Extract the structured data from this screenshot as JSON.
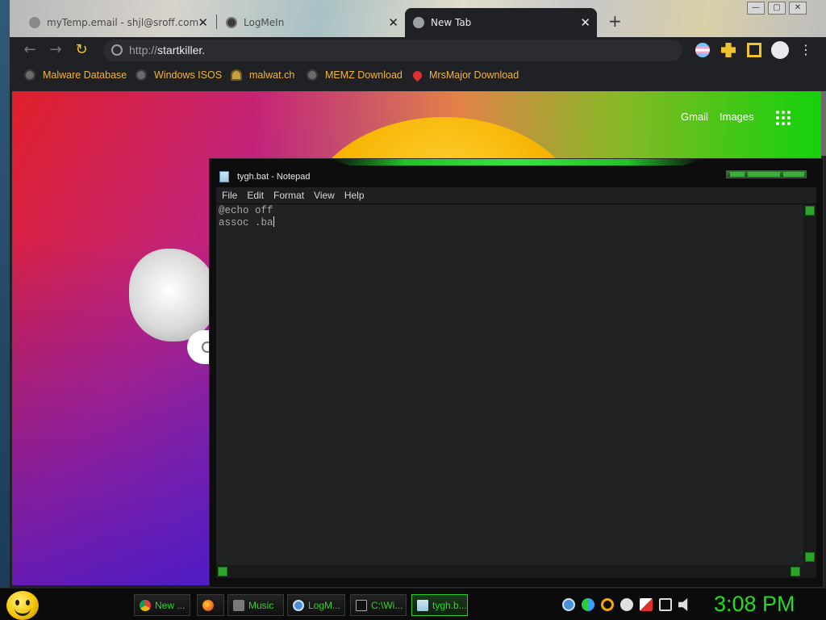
{
  "browser": {
    "tabs": [
      {
        "label": "myTemp.email - shjl@sroff.com",
        "active": false
      },
      {
        "label": "LogMeIn",
        "active": false
      },
      {
        "label": "New Tab",
        "active": true
      }
    ],
    "new_tab_symbol": "+",
    "tab_close_symbol": "✕",
    "window_controls": [
      "—",
      "▢",
      "✕"
    ],
    "nav": {
      "back": "←",
      "forward": "→",
      "reload": "↻"
    },
    "address": {
      "scheme": "http://",
      "host": "startkiller."
    },
    "bookmarks": [
      {
        "label": "Malware Database",
        "icon": "globe-icon"
      },
      {
        "label": "Windows ISOS",
        "icon": "globe-icon"
      },
      {
        "label": "malwat.ch",
        "icon": "person-icon"
      },
      {
        "label": "MEMZ Download",
        "icon": "globe-icon"
      },
      {
        "label": "MrsMajor Download",
        "icon": "heart-icon"
      }
    ],
    "page": {
      "links": [
        "Gmail",
        "Images"
      ]
    }
  },
  "notepad": {
    "title": "tygh.bat - Notepad",
    "menu": [
      "File",
      "Edit",
      "Format",
      "View",
      "Help"
    ],
    "content": "@echo off\nassoc .ba"
  },
  "taskbar": {
    "buttons": [
      {
        "label": "New ...",
        "icon": "chrome-icon",
        "active": false
      },
      {
        "label": "",
        "icon": "firefox-icon",
        "active": false
      },
      {
        "label": "Music",
        "icon": "music-icon",
        "active": false
      },
      {
        "label": "LogM...",
        "icon": "logmein-icon",
        "active": false
      },
      {
        "label": "C:\\Wi...",
        "icon": "cmd-icon",
        "active": false
      },
      {
        "label": "tygh.b...",
        "icon": "notepad-icon",
        "active": true
      }
    ],
    "clock": "3:08 PM"
  },
  "colors": {
    "accent_green": "#22dd22",
    "bookmark_text": "#f2b33d"
  }
}
